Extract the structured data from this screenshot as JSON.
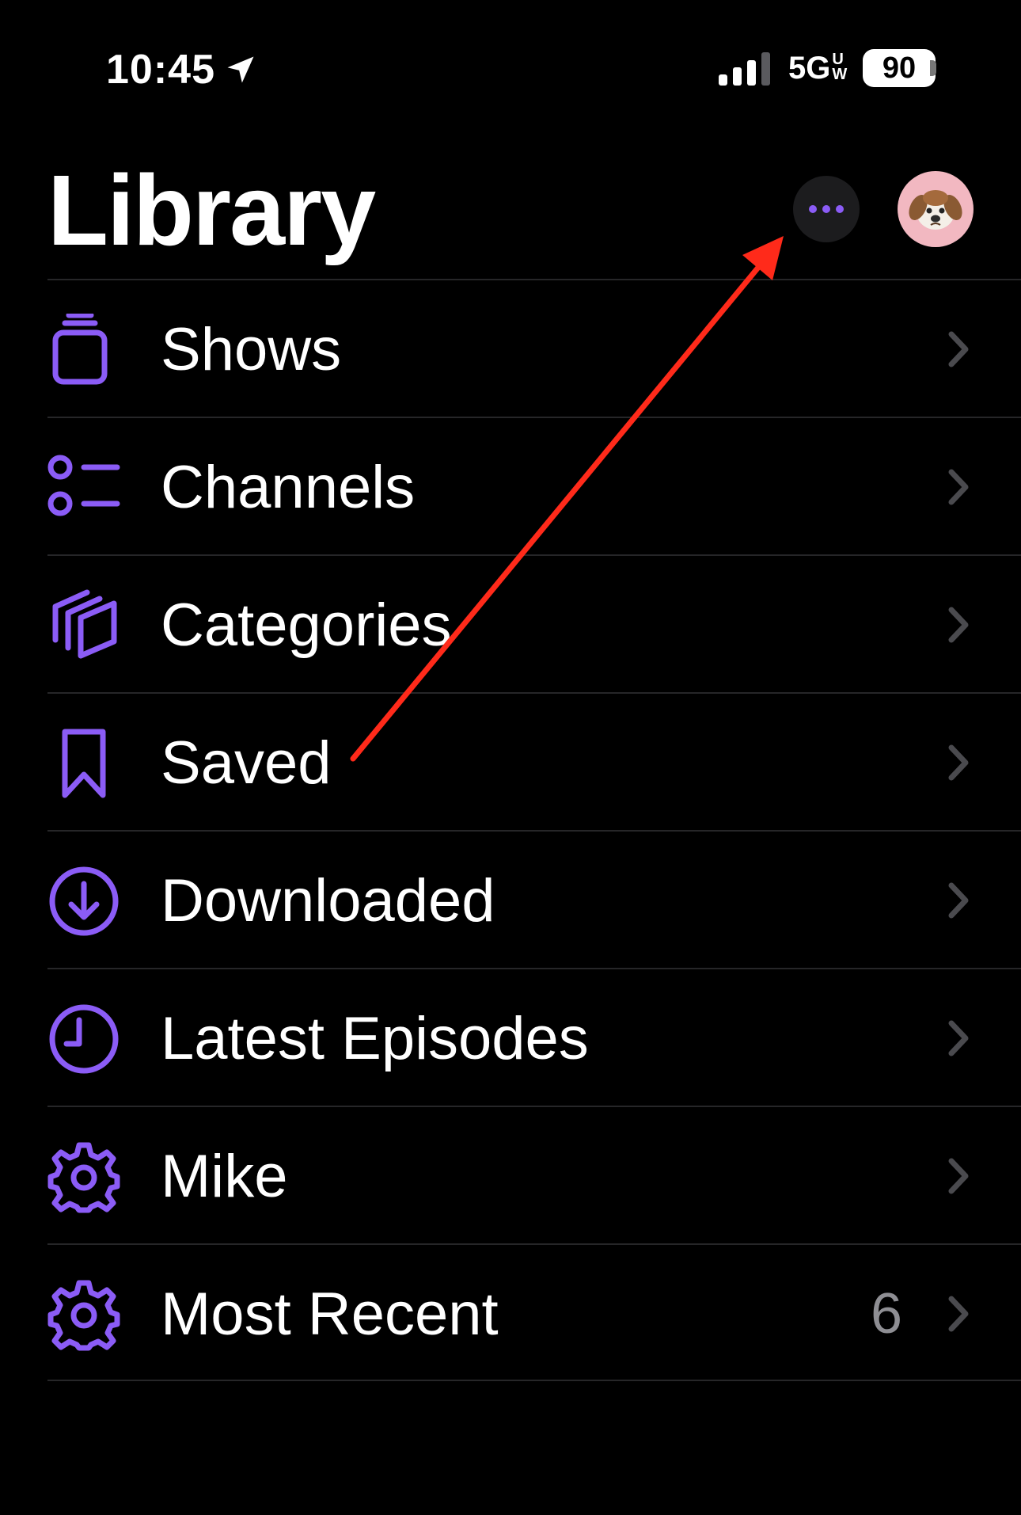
{
  "status_bar": {
    "time": "10:45",
    "network_main": "5G",
    "network_sub_top": "U",
    "network_sub_bottom": "W",
    "battery": "90"
  },
  "header": {
    "title": "Library",
    "more_icon": "ellipsis-icon",
    "avatar_icon": "dog-avatar"
  },
  "colors": {
    "accent": "#8b5cf6",
    "annotation": "#ff2a1a"
  },
  "list": {
    "items": [
      {
        "label": "Shows",
        "icon": "shows-stack-icon",
        "badge": ""
      },
      {
        "label": "Channels",
        "icon": "channels-list-icon",
        "badge": ""
      },
      {
        "label": "Categories",
        "icon": "categories-icon",
        "badge": ""
      },
      {
        "label": "Saved",
        "icon": "bookmark-icon",
        "badge": ""
      },
      {
        "label": "Downloaded",
        "icon": "download-circle-icon",
        "badge": ""
      },
      {
        "label": "Latest Episodes",
        "icon": "clock-icon",
        "badge": ""
      },
      {
        "label": "Mike",
        "icon": "gear-icon",
        "badge": ""
      },
      {
        "label": "Most Recent",
        "icon": "gear-icon",
        "badge": "6"
      }
    ]
  }
}
